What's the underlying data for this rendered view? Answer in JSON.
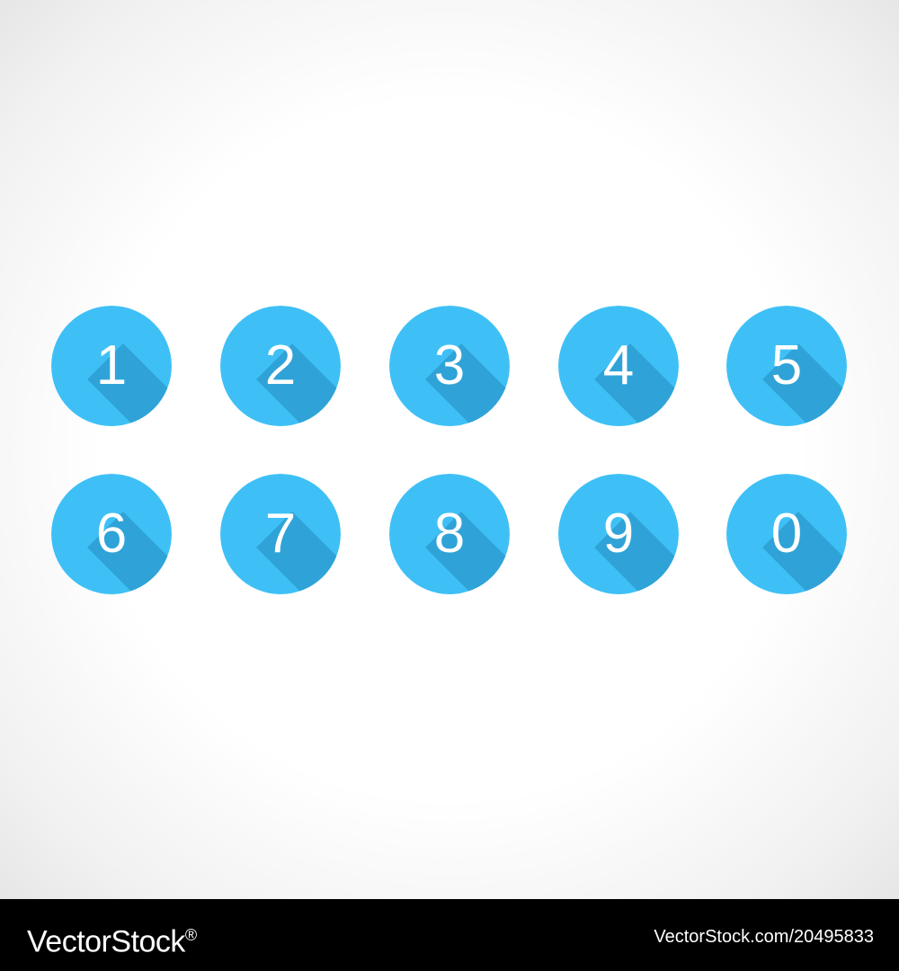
{
  "badges": [
    {
      "digit": "1"
    },
    {
      "digit": "2"
    },
    {
      "digit": "3"
    },
    {
      "digit": "4"
    },
    {
      "digit": "5"
    },
    {
      "digit": "6"
    },
    {
      "digit": "7"
    },
    {
      "digit": "8"
    },
    {
      "digit": "9"
    },
    {
      "digit": "0"
    }
  ],
  "colors": {
    "badge_fill": "#3ec0f6",
    "long_shadow": "#2fa3d8",
    "digit": "#ffffff",
    "footer_bg": "#000000"
  },
  "footer": {
    "logo_text": "VectorStock",
    "logo_mark": "®",
    "image_id": "VectorStock.com/20495833"
  }
}
